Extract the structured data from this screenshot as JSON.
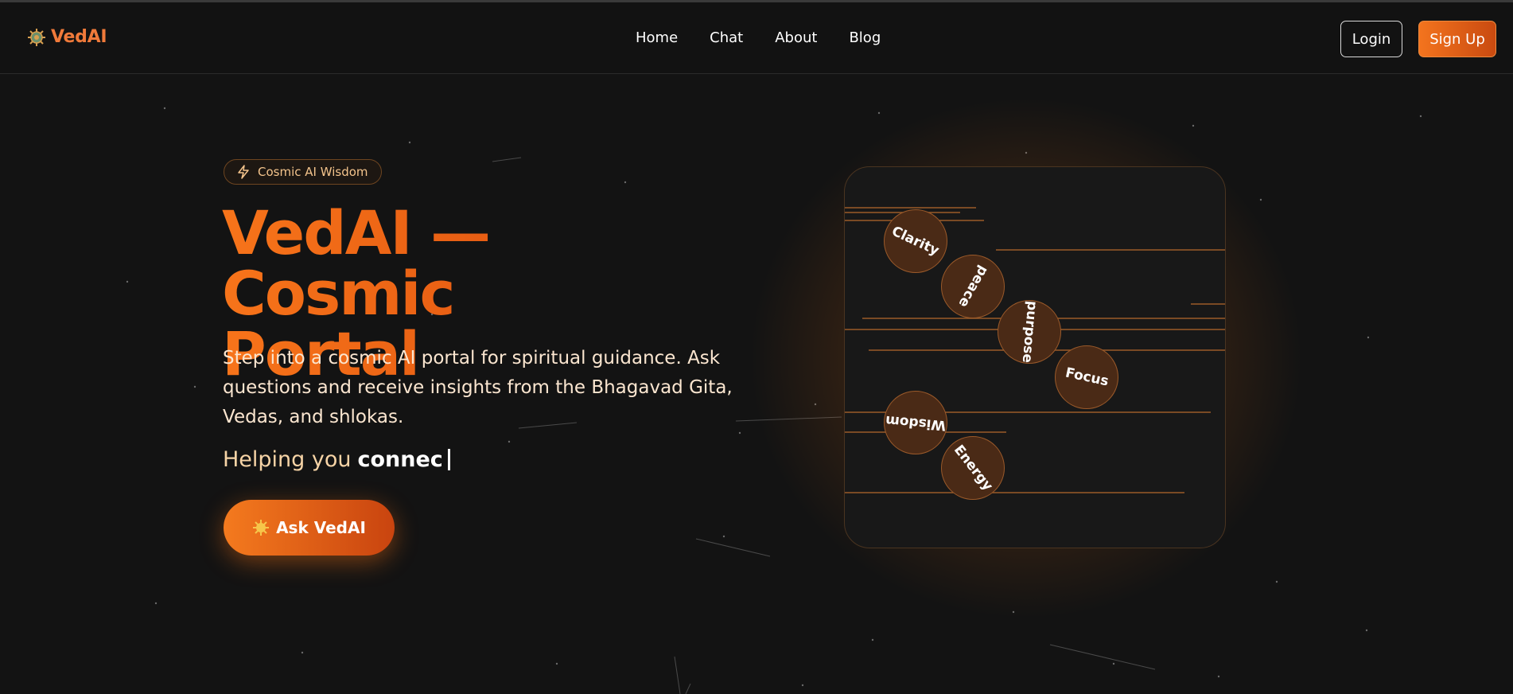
{
  "header": {
    "brand": "VedAI",
    "nav": [
      "Home",
      "Chat",
      "About",
      "Blog"
    ],
    "login_label": "Login",
    "signup_label": "Sign Up"
  },
  "hero": {
    "badge": "Cosmic AI Wisdom",
    "title_line1": "VedAI — Cosmic",
    "title_line2": "Portal",
    "description": "Step into a cosmic AI portal for spiritual guidance. Ask questions and receive insights from the Bhagavad Gita, Vedas, and shlokas.",
    "typing_prefix": "Helping you",
    "typing_word": "connec",
    "cta_label": "Ask VedAI"
  },
  "portal": {
    "words": [
      "Clarity",
      "peace",
      "purpose",
      "Focus",
      "Wisdom",
      "Energy"
    ]
  },
  "colors": {
    "accent": "#f07a3a",
    "background": "#131313"
  }
}
